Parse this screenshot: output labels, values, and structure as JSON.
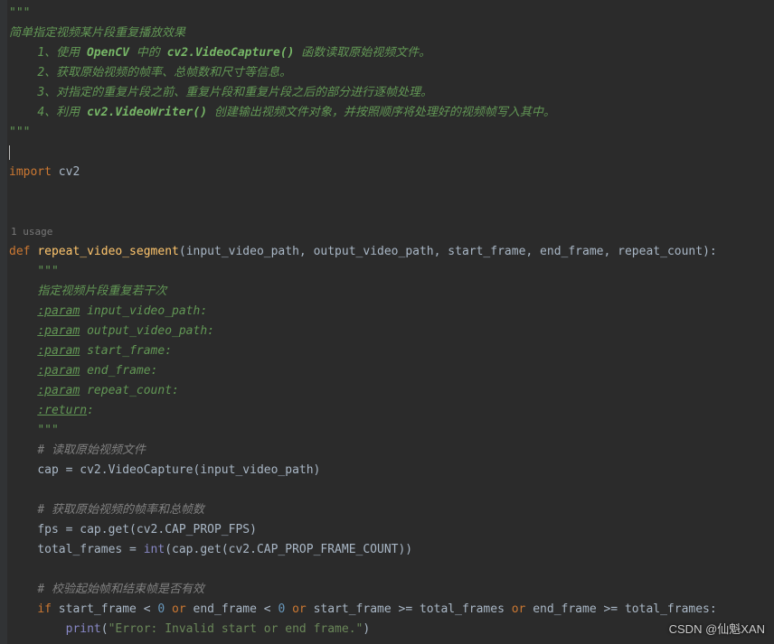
{
  "docstring": {
    "open": "\"\"\"",
    "title": "简单指定视频某片段重复播放效果",
    "steps": [
      {
        "num": "1、",
        "prefix": "使用 ",
        "code": "OpenCV",
        "mid": " 中的 ",
        "code2": "cv2.VideoCapture()",
        "suffix": " 函数读取原始视频文件。"
      },
      {
        "num": "2、",
        "prefix": "获取原始视频的帧率、总帧数和尺寸等信息。"
      },
      {
        "num": "3、",
        "prefix": "对指定的重复片段之前、重复片段和重复片段之后的部分进行逐帧处理。"
      },
      {
        "num": "4、",
        "prefix": "利用 ",
        "code": "cv2.VideoWriter()",
        "suffix": " 创建输出视频文件对象，并按照顺序将处理好的视频帧写入其中。"
      }
    ],
    "close": "\"\"\""
  },
  "import_line": {
    "kw": "import",
    "mod": "cv2"
  },
  "usage_hint": "1 usage",
  "func": {
    "def": "def ",
    "name": "repeat_video_segment",
    "lparen": "(",
    "params": [
      "input_video_path",
      "output_video_path",
      "start_frame",
      "end_frame",
      "repeat_count"
    ],
    "rparen": "):"
  },
  "fn_doc": {
    "open": "\"\"\"",
    "desc": "指定视频片段重复若干次",
    "params": [
      {
        "tag": ":param",
        "name": " input_video_path:"
      },
      {
        "tag": ":param",
        "name": " output_video_path:"
      },
      {
        "tag": ":param",
        "name": " start_frame:"
      },
      {
        "tag": ":param",
        "name": " end_frame:"
      },
      {
        "tag": ":param",
        "name": " repeat_count:"
      }
    ],
    "return_tag": ":return",
    "return_colon": ":",
    "close": "\"\"\""
  },
  "body": {
    "c1": "# 读取原始视频文件",
    "l1_a": "cap = cv2.VideoCapture(input_video_path)",
    "c2": "# 获取原始视频的帧率和总帧数",
    "l2_a": "fps = cap.get(cv2.CAP_PROP_FPS)",
    "l2_b_pre": "total_frames = ",
    "l2_b_int": "int",
    "l2_b_post": "(cap.get(cv2.CAP_PROP_FRAME_COUNT))",
    "c3": "# 校验起始帧和结束帧是否有效",
    "if_kw": "if",
    "if_body_1": " start_frame < ",
    "zero1": "0",
    "or1": " or ",
    "if_body_2": "end_frame < ",
    "zero2": "0",
    "or2": " or ",
    "if_body_3": "start_frame >= total_frames ",
    "or3": "or ",
    "if_body_4": "end_frame >= total_frames:",
    "print_fn": "print",
    "print_lp": "(",
    "print_str": "\"Error: Invalid start or end frame.\"",
    "print_rp": ")"
  },
  "watermark": "CSDN @仙魁XAN"
}
